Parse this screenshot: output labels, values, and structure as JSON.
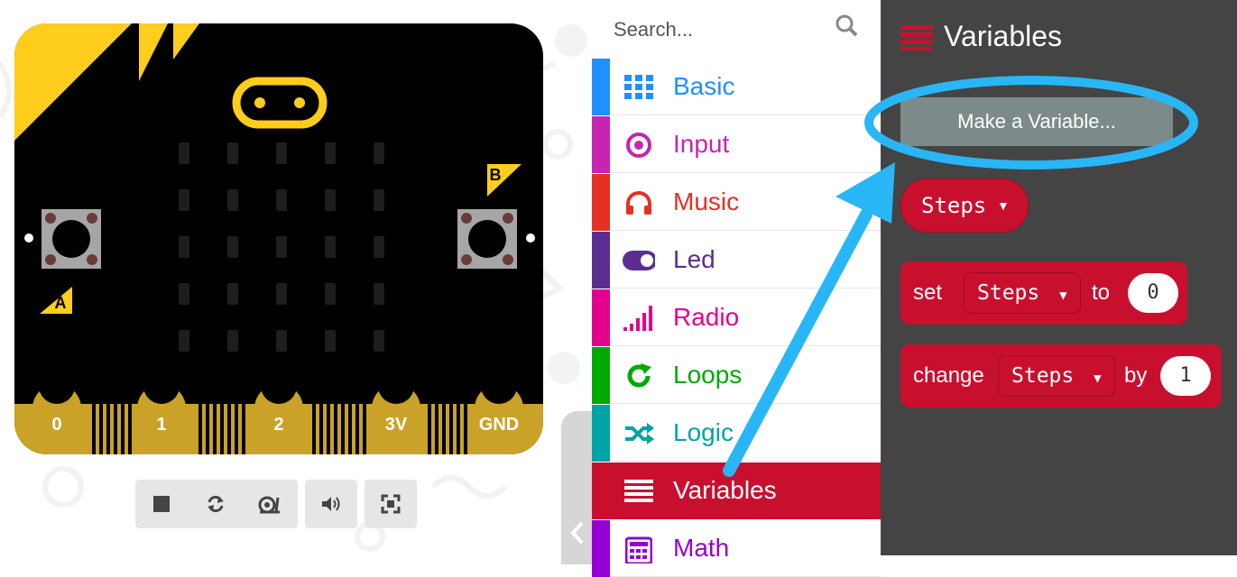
{
  "simulator": {
    "pins": [
      "0",
      "1",
      "2",
      "3V",
      "GND"
    ],
    "button_a_label": "A",
    "button_b_label": "B",
    "controls": [
      "stop-icon",
      "restart-icon",
      "slow-mo-icon",
      "sound-icon",
      "fullscreen-icon"
    ]
  },
  "toolbox": {
    "search_placeholder": "Search...",
    "categories": [
      {
        "label": "Basic",
        "color": "#1e90ff",
        "icon": "grid-icon"
      },
      {
        "label": "Input",
        "color": "#c724b1",
        "icon": "radio-target-icon"
      },
      {
        "label": "Music",
        "color": "#e63022",
        "icon": "headphones-icon"
      },
      {
        "label": "Led",
        "color": "#5c2d91",
        "icon": "toggle-icon"
      },
      {
        "label": "Radio",
        "color": "#e3008c",
        "icon": "signal-bars-icon"
      },
      {
        "label": "Loops",
        "color": "#00aa00",
        "icon": "refresh-icon"
      },
      {
        "label": "Logic",
        "color": "#00a4a6",
        "icon": "shuffle-icon"
      },
      {
        "label": "Variables",
        "color": "#dc143c",
        "icon": "list-icon"
      },
      {
        "label": "Math",
        "color": "#9400d3",
        "icon": "calculator-icon"
      }
    ],
    "selected": "Variables"
  },
  "flyout": {
    "title": "Variables",
    "make_variable_label": "Make a Variable...",
    "variable_name": "Steps",
    "set_block": {
      "keyword": "set",
      "variable": "Steps",
      "to_label": "to",
      "value": "0"
    },
    "change_block": {
      "keyword": "change",
      "variable": "Steps",
      "by_label": "by",
      "value": "1"
    }
  },
  "colors": {
    "accent_annotation": "#29b6f6",
    "board_gold": "#c9a227",
    "board_yellow": "#ffcd1c",
    "variables_red": "#c8102e",
    "flyout_bg": "#444444"
  }
}
